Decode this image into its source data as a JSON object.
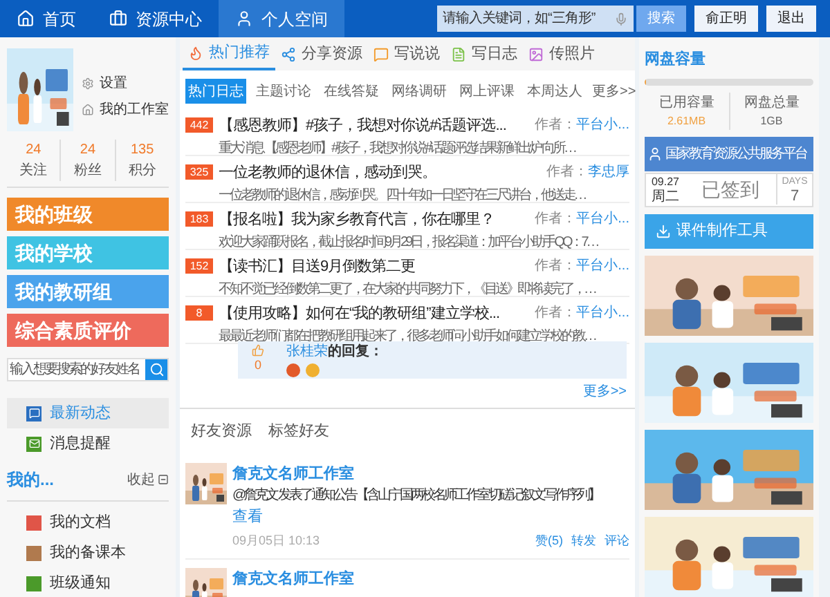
{
  "top_nav": [
    {
      "label": "首页",
      "selected": false
    },
    {
      "label": "资源中心",
      "selected": false
    },
    {
      "label": "个人空间",
      "selected": true
    }
  ],
  "search": {
    "placeholder": "请输入关键词，如“三角形”",
    "button": "搜索"
  },
  "user_button": "俞正明",
  "logout_button": "退出",
  "profile": {
    "links": [
      "设置",
      "我的工作室"
    ],
    "stats": [
      {
        "value": "24",
        "label": "关注"
      },
      {
        "value": "24",
        "label": "粉丝"
      },
      {
        "value": "135",
        "label": "积分"
      }
    ]
  },
  "banners": [
    {
      "label": "我的班级",
      "color": "#f0892a"
    },
    {
      "label": "我的学校",
      "color": "#3fc3e3"
    },
    {
      "label": "我的教研组",
      "color": "#4aa3ec"
    },
    {
      "label": "综合素质评价",
      "color": "#ee6a5c"
    }
  ],
  "friend_search": {
    "placeholder": "输入想要搜索的好友姓名"
  },
  "side_nav": [
    {
      "label": "最新动态",
      "selected": true,
      "color": "#2a6fc0"
    },
    {
      "label": "消息提醒",
      "selected": false,
      "color": "#4b9a2a"
    }
  ],
  "my_section": {
    "title": "我的...",
    "collapse": "收起"
  },
  "my_items": [
    {
      "label": "我的文档",
      "color": "#e05548"
    },
    {
      "label": "我的备课本",
      "color": "#b07a4e"
    },
    {
      "label": "班级通知",
      "color": "#4b9a2a"
    }
  ],
  "main_tabs": [
    {
      "label": "热门推荐",
      "selected": true
    },
    {
      "label": "分享资源",
      "selected": false
    },
    {
      "label": "写说说",
      "selected": false
    },
    {
      "label": "写日志",
      "selected": false
    },
    {
      "label": "传照片",
      "selected": false
    }
  ],
  "sub_tabs": [
    {
      "label": "热门日志",
      "selected": true
    },
    {
      "label": "主题讨论",
      "selected": false
    },
    {
      "label": "在线答疑",
      "selected": false
    },
    {
      "label": "网络调研",
      "selected": false
    },
    {
      "label": "网上评课",
      "selected": false
    },
    {
      "label": "本周达人",
      "selected": false
    }
  ],
  "sub_more": "更多>>",
  "posts": [
    {
      "count": "442",
      "title": "【感恩教师】#孩子，我想对你说#话题评选...",
      "author_label": "作者：",
      "author": "平台小...",
      "excerpt": "重大消息 【感恩老师】 #孩子，我想对你说#话题评选结果新鲜出炉 向所…"
    },
    {
      "count": "325",
      "title": "一位老教师的退休信，感动到哭。",
      "author_label": "作者：",
      "author": "李忠厚",
      "excerpt": "一位老教师的退休信，感动到哭。 四十年如一日坚守在三尺讲台，他送走…"
    },
    {
      "count": "183",
      "title": "【报名啦】我为家乡教育代言，你在哪里？",
      "author_label": "作者：",
      "author": "平台小...",
      "excerpt": "欢迎大家踊跃报名，截止报名时间9月29日，报名渠道：加平台小助手QQ：7…"
    },
    {
      "count": "152",
      "title": "【读书汇】目送9月倒数第二更",
      "author_label": "作者：",
      "author": "平台小...",
      "excerpt": "不知不觉已经倒数第二更了，在大家的共同努力下，《目送》即将读完了，…"
    },
    {
      "count": "8",
      "title": "【使用攻略】如何在“我的教研组”建立学校...",
      "author_label": "作者：",
      "author": "平台小...",
      "excerpt": "最最近老师们都在把教研组用起来了，很多老师问小助手如何建立学校的教…"
    }
  ],
  "reply": {
    "likes": "0",
    "user": "张桂荣",
    "suffix": "的回复："
  },
  "posts_more": "更多>>",
  "friend_tabs": [
    "好友资源",
    "标签好友"
  ],
  "feed": [
    {
      "title": "詹克文名师工作室",
      "text": "@詹克文 发表了通知公告【含山宁国两校名师工作室切磋记叙文写作序列】",
      "link": "查看",
      "time": "09月05日 10:13",
      "actions": [
        "赞(5)",
        "转发",
        "评论"
      ]
    },
    {
      "title": "詹克文名师工作室"
    }
  ],
  "storage": {
    "title": "网盘容量",
    "level": 0.01,
    "used_label": "已用容量",
    "used": "2.61MB",
    "total_label": "网盘总量",
    "total": "1GB"
  },
  "platform_button": "国家教育资源公共服务平台",
  "checkin": {
    "date": "09.27",
    "weekday": "周二",
    "status": "已签到",
    "days_label": "DAYS",
    "days": "7"
  },
  "tool_button": "课件制作工具",
  "promos": [
    {
      "kind": "picture"
    },
    {
      "kind": "picture"
    },
    {
      "kind": "picture"
    },
    {
      "kind": "picture"
    }
  ]
}
